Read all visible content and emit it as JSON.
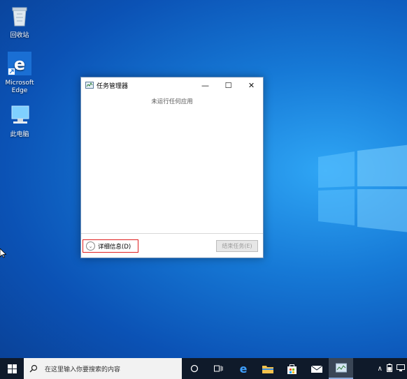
{
  "desktop": {
    "icons": [
      {
        "label": "回收站",
        "icon": "recycle-bin-icon"
      },
      {
        "label": "Microsoft Edge",
        "icon": "edge-icon"
      },
      {
        "label": "此电脑",
        "icon": "computer-icon"
      }
    ]
  },
  "task_manager": {
    "title": "任务管理器",
    "status_text": "未运行任何应用",
    "details_label": "详细信息(D)",
    "end_task_label": "结束任务(E)",
    "controls": {
      "minimize": "—",
      "maximize": "☐",
      "close": "✕"
    }
  },
  "taskbar": {
    "search_placeholder": "在这里输入你要搜索的内容",
    "tray_up": "∧",
    "accent": "#0f1a2a"
  },
  "colors": {
    "highlight_border": "#e02020",
    "wallpaper": "#0b52b5"
  }
}
